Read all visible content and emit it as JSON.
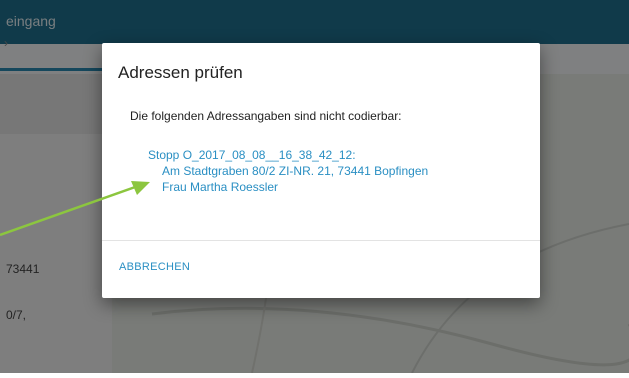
{
  "app": {
    "topbar_title": "eingang",
    "left_text_1": "73441",
    "left_text_2": "0/7,"
  },
  "dialog": {
    "title": "Adressen prüfen",
    "message": "Die folgenden Adressangaben sind nicht codierbar:",
    "entries": [
      {
        "stop": "Stopp O_2017_08_08__16_38_42_12:",
        "address": "Am Stadtgraben 80/2 ZI-NR. 21, 73441 Bopfingen",
        "name": "Frau Martha Roessler"
      }
    ],
    "cancel_label": "ABBRECHEN"
  },
  "colors": {
    "topbar": "#1f6f8f",
    "link": "#2a8fc3",
    "annotation_arrow": "#8cc63f"
  }
}
